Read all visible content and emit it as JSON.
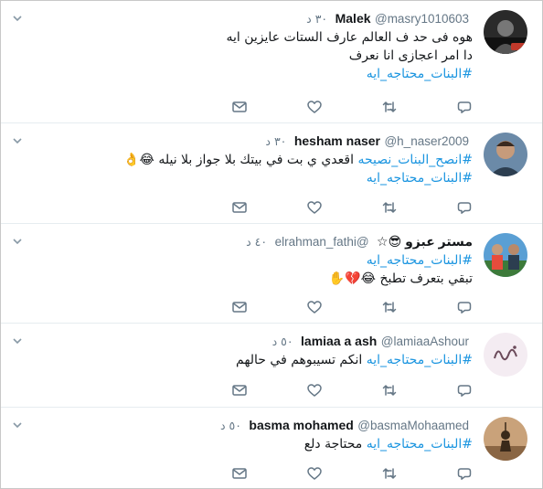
{
  "tweets": [
    {
      "name": "Malek",
      "handle": "@masry1010603",
      "time": "٣٠ د",
      "lines": [
        [
          {
            "t": "هوه فى حد ف العالم عارف الستات عايزين ايه"
          }
        ],
        [
          {
            "t": "دا امر اعجازى انا نعرف"
          }
        ],
        [
          {
            "t": "#البنات_محتاجه_ايه",
            "tag": true
          }
        ]
      ]
    },
    {
      "name": "hesham naser",
      "handle": "@h_naser2009",
      "time": "٣٠ د",
      "lines": [
        [
          {
            "t": "#انصح_البنات_نصيحه",
            "tag": true
          },
          {
            "t": " اقعدي ي بت في بيتك بلا جواز بلا نيله 😂👌"
          }
        ],
        [
          {
            "t": "#البنات_محتاجه_ايه",
            "tag": true
          }
        ]
      ]
    },
    {
      "name": "مستر عبزو 😎☆",
      "handle": "@elrahman_fathi",
      "time": "٤٠ د",
      "lines": [
        [
          {
            "t": "#البنات_محتاجه_ايه",
            "tag": true
          }
        ],
        [
          {
            "t": "تبقي بتعرف تطبخ 😂💔✋"
          }
        ]
      ]
    },
    {
      "name": "lamiaa a ash",
      "handle": "@lamiaaAshour",
      "time": "٥٠ د",
      "lines": [
        [
          {
            "t": "#البنات_محتاجه_ايه",
            "tag": true
          },
          {
            "t": "  انكم تسيبوهم في حالهم"
          }
        ]
      ]
    },
    {
      "name": "basma mohamed",
      "handle": "@basmaMohaamed",
      "time": "٥٠ د",
      "lines": [
        [
          {
            "t": "#البنات_محتاجه_ايه",
            "tag": true
          },
          {
            "t": " محتاجة دلع"
          }
        ]
      ]
    }
  ],
  "colors": {
    "link": "#1b95e0",
    "muted": "#657786",
    "text": "#14171a",
    "divider": "#e6ecf0"
  },
  "icons": [
    "chevron-down-icon",
    "reply-icon",
    "retweet-icon",
    "like-icon",
    "direct-message-icon"
  ]
}
